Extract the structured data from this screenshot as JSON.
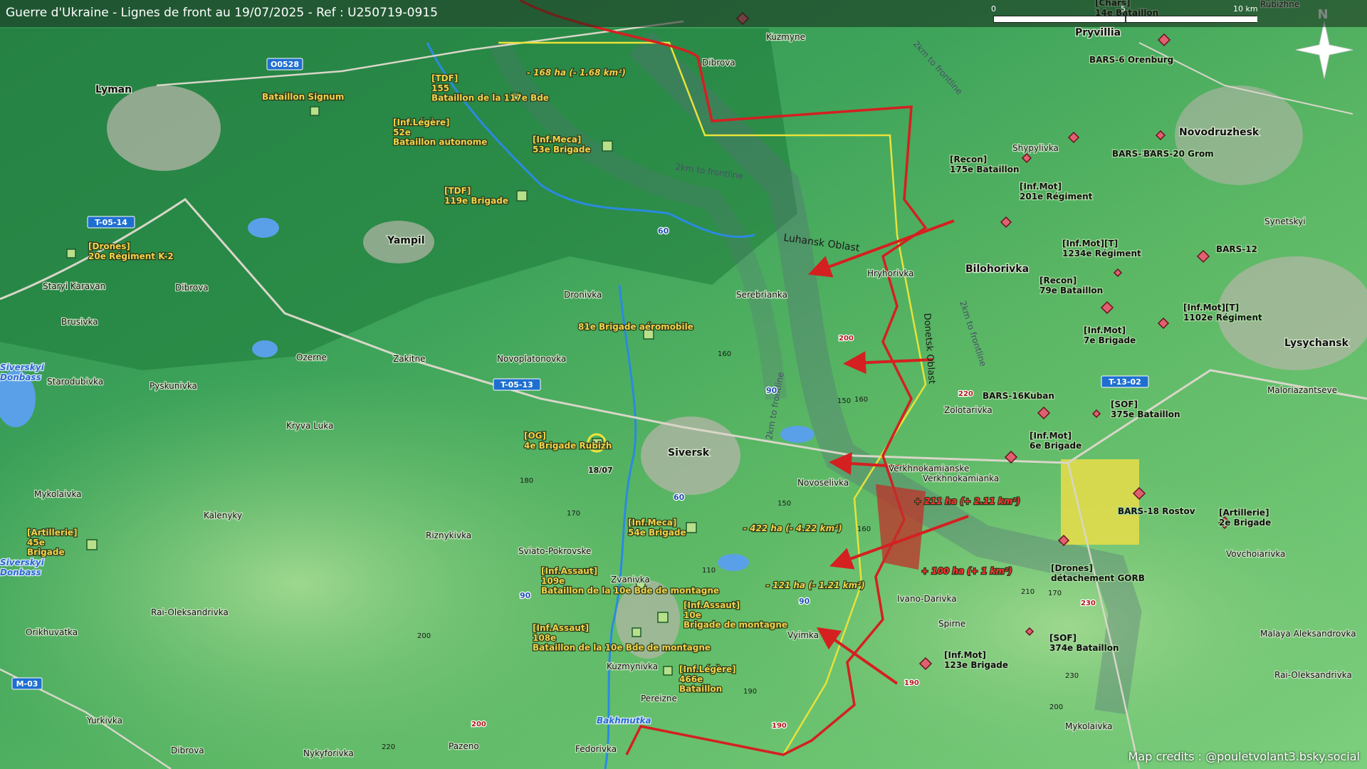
{
  "title": "Guerre d'Ukraine - Lignes de front au 19/07/2025 - Ref : U250719-0915",
  "scale": {
    "zero": "0",
    "mid": "5",
    "max": "10 km"
  },
  "north": "N",
  "credits": "Map credits : @pouletvolant3.bsky.social",
  "colors": {
    "front": "#d42020",
    "unit_label": "#f2d24a",
    "road_badge": "#1f6fd1",
    "russian_marker": "#e06070",
    "ukrainian_marker": "#b8e08a",
    "frontline_zone": "#7a6e8a"
  },
  "oblasts": [
    "Luhansk Oblast",
    "Donetsk Oblast"
  ],
  "frontline_labels": [
    "2km to frontline",
    "2km to frontline",
    "2km to frontline",
    "2km to frontline"
  ],
  "road_badges": [
    "O0528",
    "T-05-14",
    "T-05-13",
    "T-13-02",
    "M-03"
  ],
  "road_numbers": [
    "60",
    "60",
    "90",
    "90",
    "90"
  ],
  "elevations": [
    "200",
    "160",
    "150",
    "160",
    "170",
    "180",
    "150",
    "160",
    "110",
    "200",
    "200",
    "220",
    "170",
    "190",
    "190",
    "200",
    "220",
    "210",
    "230",
    "230",
    "190"
  ],
  "places": {
    "cities": [
      "Lyman",
      "Siversk",
      "Bilohorivka",
      "Lysychansk",
      "Novodruzhesk",
      "Pryvillia",
      "Yampil"
    ],
    "towns": [
      "Kuzmyne",
      "Dibrova",
      "Staryi Karavan",
      "Brusivka",
      "Dibrova",
      "Ozerne",
      "Zakitne",
      "Dronivka",
      "Novoplatonovka",
      "Starodubivka",
      "Pyskunivka",
      "Kryva Luka",
      "Mykolaivka",
      "Kalenyky",
      "Riznykivka",
      "Sviato-Pokrovske",
      "Rai-Oleksandrivka",
      "Orikhuvatka",
      "Yurkivka",
      "Dibrova",
      "Pazeno",
      "Nykyforivka",
      "Fedorivka",
      "Pereizne",
      "Kuzmynivka",
      "Zvanivka",
      "Vyimka",
      "Ivano-Darivka",
      "Novoselivka",
      "Verkhnokamianske",
      "Serebrianka",
      "Hryhorivka",
      "Zolotarivka",
      "Verkhnokamianka",
      "Spirne",
      "Mykolaivka",
      "Rai-Oleksandrivka",
      "Malaya Aleksandrovka",
      "Vovchoiarivka",
      "Maloriazantseve",
      "Synetskyi",
      "Shypylivka",
      "Rubizhne"
    ],
    "rivers": [
      "Siverskyi Donbass",
      "Siverskyi Donbass",
      "Bakhmutka"
    ]
  },
  "ukrainian_units": [
    "Bataillon Signum",
    "[TDF] 155 Bataillon de la 117e Bde",
    "[Inf.Légère] 52e Bataillon autonome",
    "[Inf.Meca] 53e Brigade",
    "[TDF] 119e Brigade",
    "[Drones] 20e Régiment K-2",
    "81e Brigade aéromobile",
    "[OG] 4e Brigade Rubizh",
    "[Inf.Meca] 54e Brigade",
    "[Inf.Assaut] 109e Bataillon de la 10e Bde de montagne",
    "[Inf.Assaut] 10e Brigade de montagne",
    "[Inf.Assaut] 108e Bataillon de la 10e Bde de montagne",
    "[Inf.Légère] 466e Bataillon",
    "[Artillerie] 45e Brigade"
  ],
  "russian_units": [
    "BARS-6 Orenburg",
    "BARS-19",
    "BARS-20 Grom",
    "[Recon] 175e Bataillon",
    "[Inf.Mot] 201e Régiment",
    "[Inf.Mot][T] 1234e Régiment",
    "BARS-12",
    "[Recon] 79e Bataillon",
    "[Inf.Mot][T] 1102e Régiment",
    "[Inf.Mot] 7e Brigade",
    "BARS-16Kuban",
    "[SOF] 375e Bataillon",
    "[Inf.Mot] 6e Brigade",
    "BARS-18 Rostov",
    "[Artillerie] 2e Brigade",
    "[Drones] détachement GORB",
    "[SOF] 374e Bataillon",
    "[Inf.Mot] 123e Brigade",
    "[Chars] 14e Bataillon"
  ],
  "changes": [
    "- 168 ha (- 1.68 km²)",
    "- 422 ha (- 4.22 km²)",
    "- 121 ha (- 1.21 km²)",
    "+ 211 ha (+ 2.11 km²)",
    "+ 100 ha (+ 1 km²)"
  ],
  "date_tag": "18/07"
}
